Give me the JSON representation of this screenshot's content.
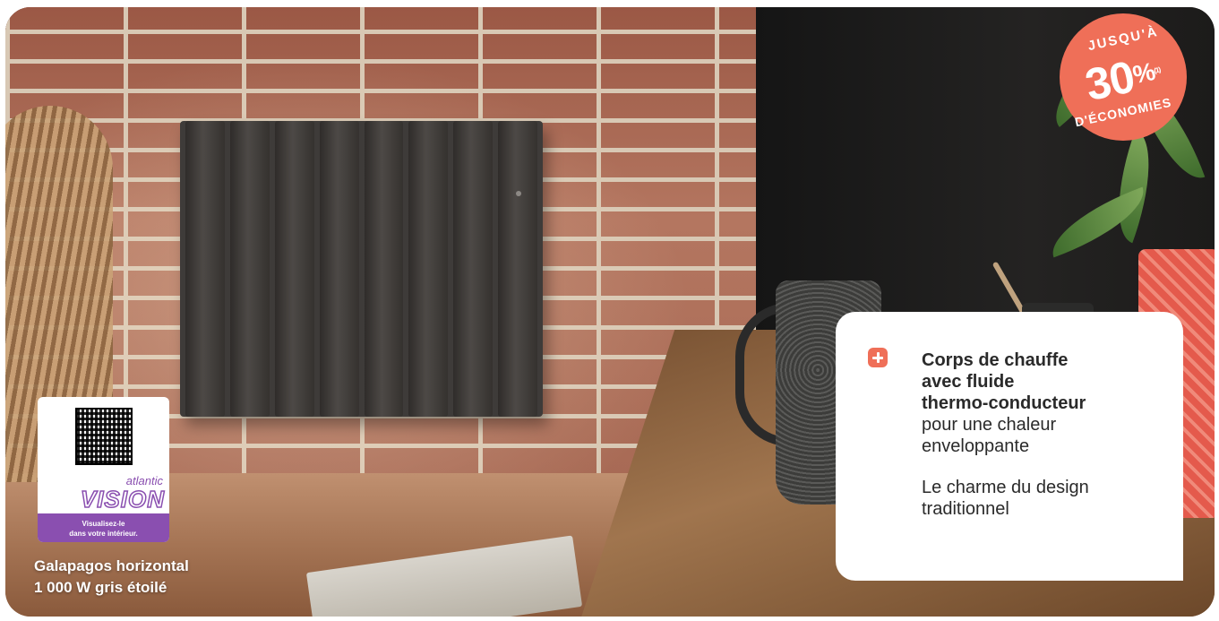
{
  "badge": {
    "top": "JUSQU'À",
    "value": "30",
    "percent": "%",
    "note": "(1)",
    "bottom": "D'ÉCONOMIES"
  },
  "feature": {
    "icon": "plus-icon",
    "bold_lines": [
      "Corps de chauffe",
      "avec fluide",
      "thermo-conducteur"
    ],
    "normal_lines": [
      "pour une chaleur",
      "enveloppante"
    ],
    "second_lines": [
      "Le charme du design",
      "traditionnel"
    ]
  },
  "qr": {
    "brand": "atlantic",
    "product": "VISION",
    "caption_lines": [
      "Visualisez-le",
      "dans votre intérieur."
    ]
  },
  "product": {
    "name_line1": "Galapagos horizontal",
    "name_line2": "1 000 W gris étoilé"
  },
  "colors": {
    "accent": "#ef6f58",
    "brand_purple": "#8a4fb0"
  }
}
